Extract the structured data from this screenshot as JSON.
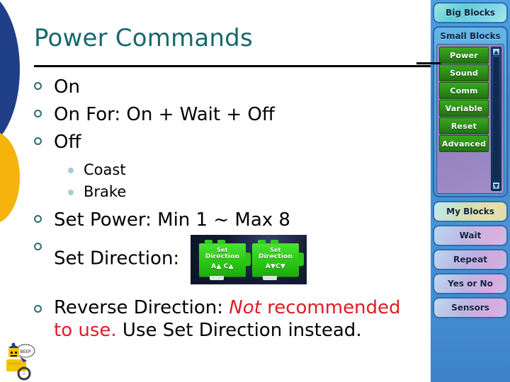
{
  "slide": {
    "title": "Power Commands",
    "bullets": [
      {
        "level": 1,
        "text": "On"
      },
      {
        "level": 1,
        "text": "On For: On + Wait + Off"
      },
      {
        "level": 1,
        "text": "Off"
      },
      {
        "level": 2,
        "text": "Coast"
      },
      {
        "level": 2,
        "text": "Brake"
      },
      {
        "level": 1,
        "text": "Set Power: Min 1 ~ Max 8"
      },
      {
        "level": 1,
        "text": "Set Direction:"
      }
    ],
    "bullet_on": "On",
    "bullet_onfor": "On For: On + Wait + Off",
    "bullet_off": "Off",
    "bullet_coast": "Coast",
    "bullet_brake": "Brake",
    "bullet_setpower": "Set Power: Min 1 ~ Max 8",
    "bullet_setdirection": "Set Direction:",
    "reverse": {
      "lead": "Reverse Direction: ",
      "emph_italic": "Not",
      "emph_rest": " recommended to use.",
      "tail": " Use Set Direction instead."
    }
  },
  "blocks_image": {
    "alt": "two green Set Direction NXT blocks",
    "block_left": {
      "line1": "Set",
      "line2": "Direction",
      "line3": "A▲ C▲"
    },
    "block_right": {
      "line1": "Set",
      "line2": "Direction",
      "line3": "A▼C▼"
    }
  },
  "palette": {
    "big_blocks_label": "Big Blocks",
    "small_blocks_label": "Small Blocks",
    "categories": [
      "Power",
      "Sound",
      "Comm",
      "Variable",
      "Reset",
      "Advanced"
    ],
    "lower_buttons": [
      "My Blocks",
      "Wait",
      "Repeat",
      "Yes or No",
      "Sensors"
    ],
    "scroll_up": "▲",
    "scroll_down": "▼"
  },
  "colors": {
    "title_teal": "#17686B",
    "bullet_marker_teal": "#2A6E72",
    "sub_marker_blue": "#A8CCD6",
    "emphasis_red": "#E01B24",
    "deco_blue": "#1F4089",
    "deco_gold": "#F5B30C",
    "palette_blue": "#3E8FD8",
    "category_green": "#2B8C17"
  }
}
